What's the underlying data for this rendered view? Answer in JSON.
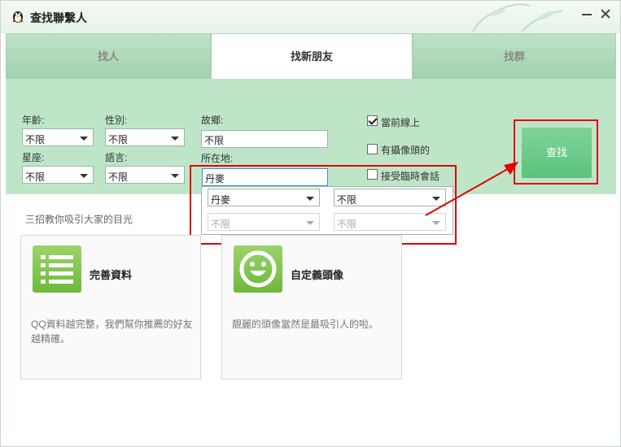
{
  "window": {
    "title": "查找聯繫人"
  },
  "tabs": [
    {
      "label": "找人"
    },
    {
      "label": "找新朋友"
    },
    {
      "label": "找群"
    }
  ],
  "filters": {
    "age": {
      "label": "年齡:",
      "value": "不限"
    },
    "gender": {
      "label": "性別:",
      "value": "不限"
    },
    "zodiac": {
      "label": "星座:",
      "value": "不限"
    },
    "language": {
      "label": "語言:",
      "value": "不限"
    },
    "hometown": {
      "label": "故鄉:",
      "value": "不限"
    },
    "location": {
      "label": "所在地:",
      "value": "丹麥",
      "country": "丹麥",
      "province": "不限",
      "city": "不限",
      "district": "不限"
    },
    "online_now": {
      "label": "當前線上",
      "checked": true
    },
    "has_camera": {
      "label": "有攝像頭的",
      "checked": false
    },
    "accept_temp_chat": {
      "label": "接受臨時會話",
      "checked": false
    }
  },
  "search_button": {
    "label": "查找"
  },
  "tips": {
    "heading": "三招教你吸引大家的目光"
  },
  "cards": [
    {
      "title": "完善資料",
      "desc": "QQ資料越完整，我們幫你推薦的好友越精確。",
      "icon": "list-icon"
    },
    {
      "title": "自定義頭像",
      "desc": "靚麗的頭像當然是最吸引人的啦。",
      "icon": "smiley-icon"
    }
  ],
  "colors": {
    "accent_green": "#5cc27c",
    "annotation_red": "#e00000"
  }
}
